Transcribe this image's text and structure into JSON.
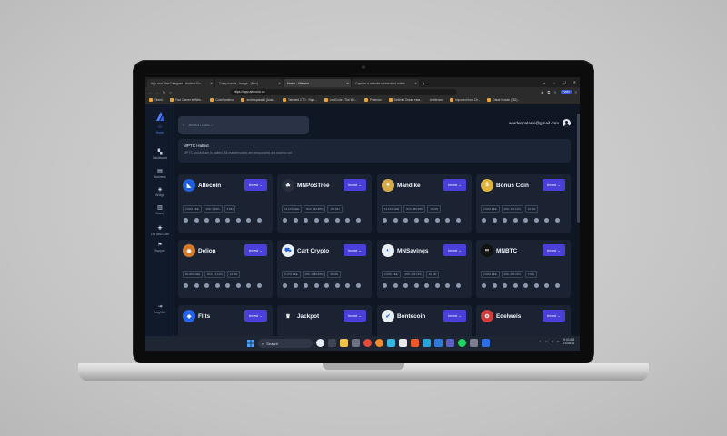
{
  "browser": {
    "tabs": [
      {
        "label": "App and Web Designer - Andrew Ru",
        "active": false
      },
      {
        "label": "Components - Image - (Neo)",
        "active": false
      },
      {
        "label": "Home - Altecoin",
        "active": true
      },
      {
        "label": "Capture a website screenshot online",
        "active": false
      }
    ],
    "new_tab": "+",
    "window_controls": [
      "⌄",
      "–",
      "☐",
      "✕"
    ],
    "url": "https://app.altecoin.cc",
    "vpn_label": "• VPN",
    "bookmarks": [
      "Tinted",
      "Your Career in Web...",
      "CodeSandbox",
      "andrewpalaski (Andr...",
      "Talented CTO - Rapi...",
      "LeetCode - The Wo...",
      "Postman",
      "Definitiv Ocean esta...",
      "Ambience",
      "Imported from Ch...",
      "Dalak Musab (752)..."
    ]
  },
  "sidebar": {
    "items": [
      {
        "label": "Home",
        "icon": "⌂",
        "active": true
      },
      {
        "label": "Dashboard",
        "icon": "▚",
        "active": false
      },
      {
        "label": "Business",
        "icon": "▤",
        "active": false
      },
      {
        "label": "Bridge",
        "icon": "◈",
        "active": false
      },
      {
        "label": "History",
        "icon": "▥",
        "active": false
      },
      {
        "label": "List New Coin",
        "icon": "✚",
        "active": false
      },
      {
        "label": "Support",
        "icon": "⚑",
        "active": false
      }
    ],
    "logout": {
      "label": "Log Out",
      "icon": "⇥"
    }
  },
  "search": {
    "placeholder": "Search Coin..."
  },
  "user": {
    "email": "wardenpalaski@gmail.com"
  },
  "alert": {
    "title": "MPTC Halted",
    "text": "MPTC blockchain is halted. All masternodes are temporarily not paying out."
  },
  "invest_label": "Invest →",
  "coins": [
    {
      "name": "Altecoin",
      "color": "#1f5fd9",
      "glyph": "◣",
      "fee": "2.00% FEE",
      "roi": "ROI: 0.39%",
      "mn": "5 MN"
    },
    {
      "name": "MNPoSTree",
      "color": "#2a2f3c",
      "glyph": "☘",
      "fee": "14.10% FEE",
      "roi": "ROI: 166.88%",
      "mn": "155 MN"
    },
    {
      "name": "Mandike",
      "color": "#d6a94a",
      "glyph": "●",
      "fee": "12.10% FEE",
      "roi": "ROI: 386.99%",
      "mn": "10 MN"
    },
    {
      "name": "Bonus Coin",
      "color": "#e0b53c",
      "glyph": "$",
      "fee": "2.00% FEE",
      "roi": "ROI: 171.13%",
      "mn": "16 MN"
    },
    {
      "name": "Delion",
      "color": "#d07a2a",
      "glyph": "◉",
      "fee": "50.20% FEE",
      "roi": "ROI: 15.12%",
      "mn": "14 MN"
    },
    {
      "name": "Cart Crypto",
      "color": "#e9eef5",
      "glyph": "⛟",
      "fee": "5.17% FEE",
      "roi": "ROI: 1980.83%",
      "mn": "38 MN"
    },
    {
      "name": "MNSavings",
      "color": "#e9eef5",
      "glyph": "◐",
      "fee": "2.00% FEE",
      "roi": "ROI: 493.72%",
      "mn": "16 MN"
    },
    {
      "name": "MNBTC",
      "color": "#111111",
      "glyph": "∞",
      "fee": "2.00% FEE",
      "roi": "ROI: 285.76%",
      "mn": "0 MN"
    },
    {
      "name": "Flits",
      "color": "#2563eb",
      "glyph": "◆",
      "fee": "",
      "roi": "",
      "mn": ""
    },
    {
      "name": "Jackpot",
      "color": "#1b2333",
      "glyph": "♛",
      "fee": "",
      "roi": "",
      "mn": ""
    },
    {
      "name": "Bontecoin",
      "color": "#e9eef5",
      "glyph": "✔",
      "fee": "",
      "roi": "",
      "mn": ""
    },
    {
      "name": "Edelweis",
      "color": "#d33a3a",
      "glyph": "✿",
      "fee": "",
      "roi": "",
      "mn": ""
    }
  ],
  "taskbar": {
    "search_label": "Search",
    "time": "9:00 AM",
    "date": "21/05/23"
  }
}
